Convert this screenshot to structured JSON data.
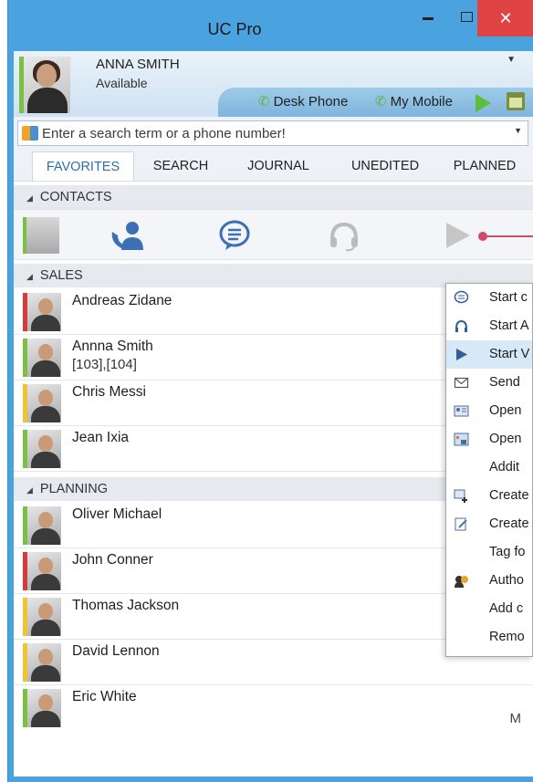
{
  "window": {
    "title": "UC Pro",
    "close_glyph": "✕"
  },
  "user": {
    "name": "ANNA SMITH",
    "status": "Available"
  },
  "devices": {
    "desk_phone": "Desk Phone",
    "my_mobile": "My Mobile"
  },
  "search": {
    "placeholder": "Enter a search term or a phone number!"
  },
  "tabs": [
    {
      "label": "FAVORITES",
      "active": true
    },
    {
      "label": "SEARCH"
    },
    {
      "label": "JOURNAL"
    },
    {
      "label": "UNEDITED"
    },
    {
      "label": "PLANNED"
    }
  ],
  "groups": {
    "contacts": "CONTACTS",
    "sales": "SALES",
    "planning": "PLANNING"
  },
  "sales": [
    {
      "name": "Andreas Zidane",
      "status": "red"
    },
    {
      "name": "Annna Smith",
      "ext": "[103],[104]",
      "status": "green"
    },
    {
      "name": "Chris Messi",
      "status": "yellow"
    },
    {
      "name": "Jean Ixia",
      "status": "green"
    }
  ],
  "planning": [
    {
      "name": "Oliver Michael",
      "status": "green"
    },
    {
      "name": "John Conner",
      "status": "red"
    },
    {
      "name": "Thomas Jackson",
      "status": "yellow"
    },
    {
      "name": "David Lennon",
      "status": "yellow"
    },
    {
      "name": "Eric White",
      "status": "green",
      "right": "M"
    }
  ],
  "menu": [
    {
      "label": "Start c",
      "icon": "chat-icon"
    },
    {
      "label": "Start A",
      "icon": "headset-icon"
    },
    {
      "label": "Start V",
      "icon": "play-icon",
      "highlighted": true
    },
    {
      "label": "Send",
      "icon": "mail-icon"
    },
    {
      "label": "Open",
      "icon": "contact-card-icon"
    },
    {
      "label": "Open",
      "icon": "calendar-contact-icon"
    },
    {
      "label": "Addit",
      "icon": ""
    },
    {
      "label": "Create",
      "icon": "create-contact-icon"
    },
    {
      "label": "Create",
      "icon": "create-note-icon"
    },
    {
      "label": "Tag fo",
      "icon": ""
    },
    {
      "label": "Autho",
      "icon": "authorize-icon"
    },
    {
      "label": "Add c",
      "icon": ""
    },
    {
      "label": "Remo",
      "icon": ""
    }
  ],
  "colors": {
    "accent": "#4aa3df",
    "available": "#7cc043",
    "busy": "#d63a3a",
    "away": "#f1c232"
  }
}
